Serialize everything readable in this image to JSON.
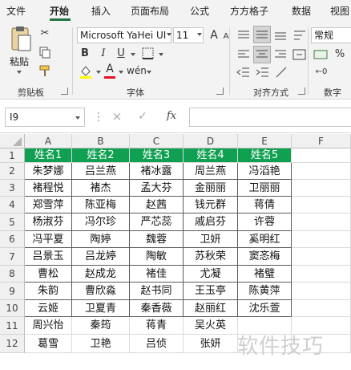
{
  "tabs": [
    "文件",
    "开始",
    "插入",
    "页面布局",
    "公式",
    "方方格子",
    "数据",
    "视图"
  ],
  "clipboard": {
    "paste_label": "粘贴",
    "group_label": "剪贴板"
  },
  "font": {
    "name": "Microsoft YaHei UI",
    "size": "11",
    "bold": "B",
    "italic": "I",
    "underline": "U",
    "group_label": "字体",
    "grow": "A",
    "shrink": "A",
    "color_letter": "A"
  },
  "alignment": {
    "group_label": "对齐方式"
  },
  "number": {
    "format": "常规",
    "group_label": "数字"
  },
  "formula_bar": {
    "cell_ref": "I9",
    "fx": "fx"
  },
  "sheet": {
    "columns": [
      "A",
      "B",
      "C",
      "D",
      "E",
      "F"
    ],
    "rows": [
      "1",
      "2",
      "3",
      "4",
      "5",
      "6",
      "7",
      "8",
      "9",
      "10",
      "11",
      "12"
    ],
    "header": [
      "姓名1",
      "姓名2",
      "姓名3",
      "姓名4",
      "姓名5"
    ],
    "data": [
      [
        "朱梦娜",
        "吕兰燕",
        "褚冰露",
        "周兰燕",
        "冯滔艳"
      ],
      [
        "褚程悦",
        "褚杰",
        "孟大芬",
        "金丽丽",
        "卫丽丽"
      ],
      [
        "郑雪萍",
        "陈亚梅",
        "赵茜",
        "钱元群",
        "蒋倩"
      ],
      [
        "杨淑芬",
        "冯尔珍",
        "严芯蕊",
        "戚启芬",
        "许蓉"
      ],
      [
        "冯平夏",
        "陶婷",
        "魏蓉",
        "卫妍",
        "奚明红"
      ],
      [
        "吕景玉",
        "吕龙婷",
        "陶敏",
        "苏秋荣",
        "窦忞梅"
      ],
      [
        "曹松",
        "赵成龙",
        "褚佳",
        "尤凝",
        "褚璧"
      ],
      [
        "朱韵",
        "曹欣淼",
        "赵书同",
        "王玉亭",
        "陈黄萍"
      ],
      [
        "云姬",
        "卫夏青",
        "秦香薇",
        "赵丽红",
        "沈乐萱"
      ],
      [
        "周兴怡",
        "秦筠",
        "蒋青",
        "吴火英",
        ""
      ],
      [
        "葛雪",
        "卫艳",
        "吕侦",
        "张妍",
        ""
      ]
    ]
  },
  "watermark": "软件技巧"
}
